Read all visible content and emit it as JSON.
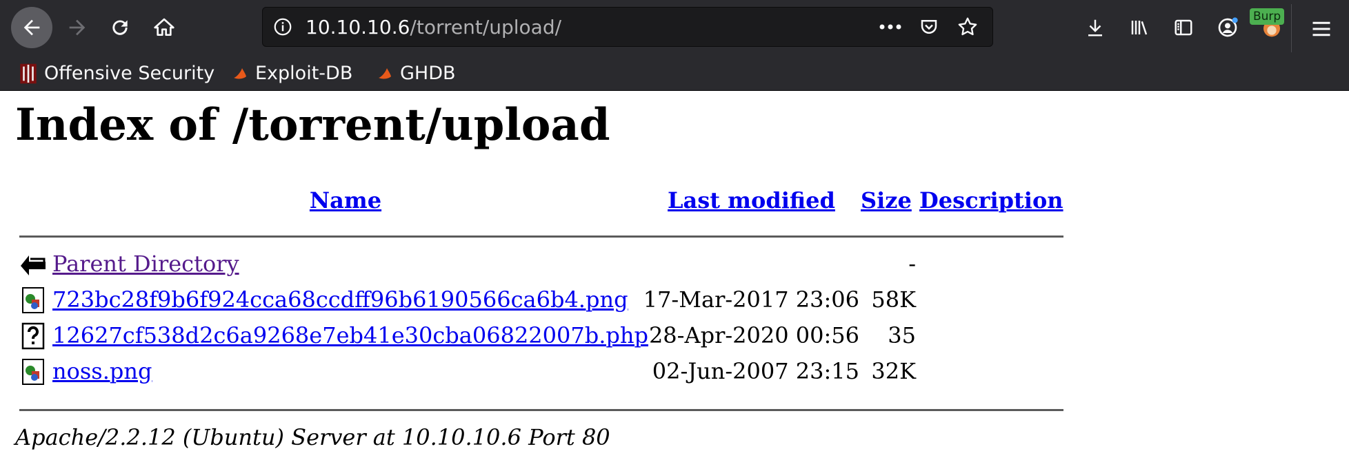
{
  "browser": {
    "url_host": "10.10.10.6",
    "url_path": "/torrent/upload/",
    "burp_badge": "Burp",
    "bookmarks": [
      {
        "label": "Offensive Security",
        "icon": "offsec-icon"
      },
      {
        "label": "Exploit-DB",
        "icon": "exploitdb-icon"
      },
      {
        "label": "GHDB",
        "icon": "ghdb-icon"
      }
    ],
    "accent": "#2a2a2e"
  },
  "page": {
    "title": "Index of /torrent/upload",
    "columns": {
      "name": "Name",
      "last_modified": "Last modified",
      "size": "Size",
      "description": "Description"
    },
    "rows": [
      {
        "name": "Parent Directory",
        "modified": "",
        "size": "-",
        "icon": "back-arrow-icon",
        "visited": true
      },
      {
        "name": "723bc28f9b6f924cca68ccdff96b6190566ca6b4.png",
        "modified": "17-Mar-2017 23:06",
        "size": "58K",
        "icon": "image-file-icon"
      },
      {
        "name": "12627cf538d2c6a9268e7eb41e30cba06822007b.php",
        "modified": "28-Apr-2020 00:56",
        "size": "35",
        "icon": "unknown-file-icon"
      },
      {
        "name": "noss.png",
        "modified": "02-Jun-2007 23:15",
        "size": "32K",
        "icon": "image-file-icon"
      }
    ],
    "address": "Apache/2.2.12 (Ubuntu) Server at 10.10.10.6 Port 80",
    "link_color": "#0000ee",
    "visited_color": "#551a8b"
  }
}
